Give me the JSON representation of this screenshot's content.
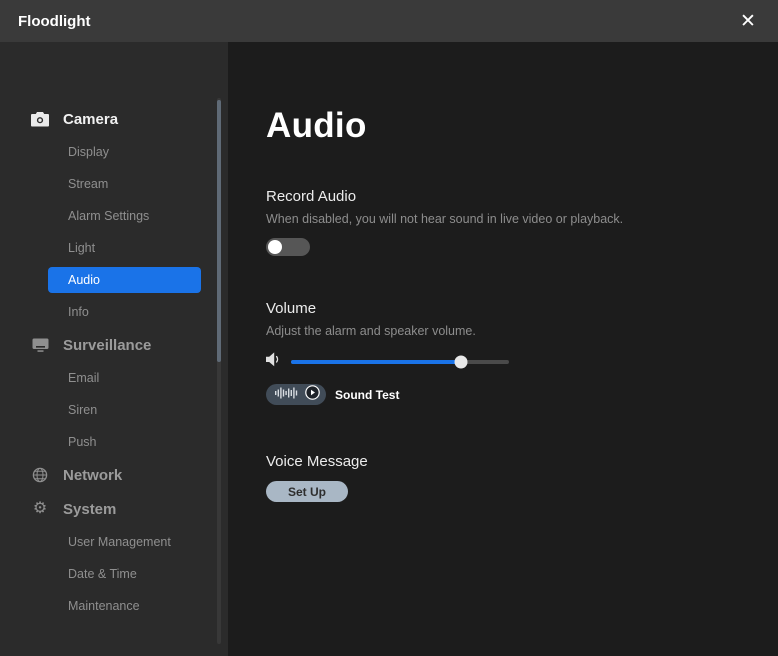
{
  "window": {
    "title": "Floodlight",
    "close_glyph": "✕"
  },
  "sidebar": {
    "active_item": "Audio",
    "sections": [
      {
        "label": "Camera",
        "icon": "camera-icon",
        "items": [
          "Display",
          "Stream",
          "Alarm Settings",
          "Light",
          "Audio",
          "Info"
        ]
      },
      {
        "label": "Surveillance",
        "icon": "monitor-icon",
        "items": [
          "Email",
          "Siren",
          "Push"
        ]
      },
      {
        "label": "Network",
        "icon": "globe-icon",
        "items": []
      },
      {
        "label": "System",
        "icon": "gear-icon",
        "items": [
          "User Management",
          "Date & Time",
          "Maintenance"
        ]
      }
    ]
  },
  "main": {
    "title": "Audio",
    "record_audio": {
      "label": "Record Audio",
      "description": "When disabled, you will not hear sound in live video or playback.",
      "enabled": false
    },
    "volume": {
      "label": "Volume",
      "description": "Adjust the alarm and speaker volume.",
      "value_percent": 78,
      "sound_test_label": "Sound Test"
    },
    "voice_message": {
      "label": "Voice Message",
      "button_label": "Set Up"
    }
  },
  "icons": [
    "camera-icon",
    "monitor-icon",
    "globe-icon",
    "gear-icon",
    "close-icon",
    "speaker-icon",
    "waveform-icon",
    "play-icon"
  ],
  "colors": {
    "accent_blue": "#1a73e8",
    "titlebar_bg": "#3a3a3a",
    "sidebar_bg": "#2b2b2b",
    "content_bg": "#1c1c1c",
    "setup_button_bg": "#a9b7c5",
    "soundtest_button_bg": "#414c58"
  }
}
